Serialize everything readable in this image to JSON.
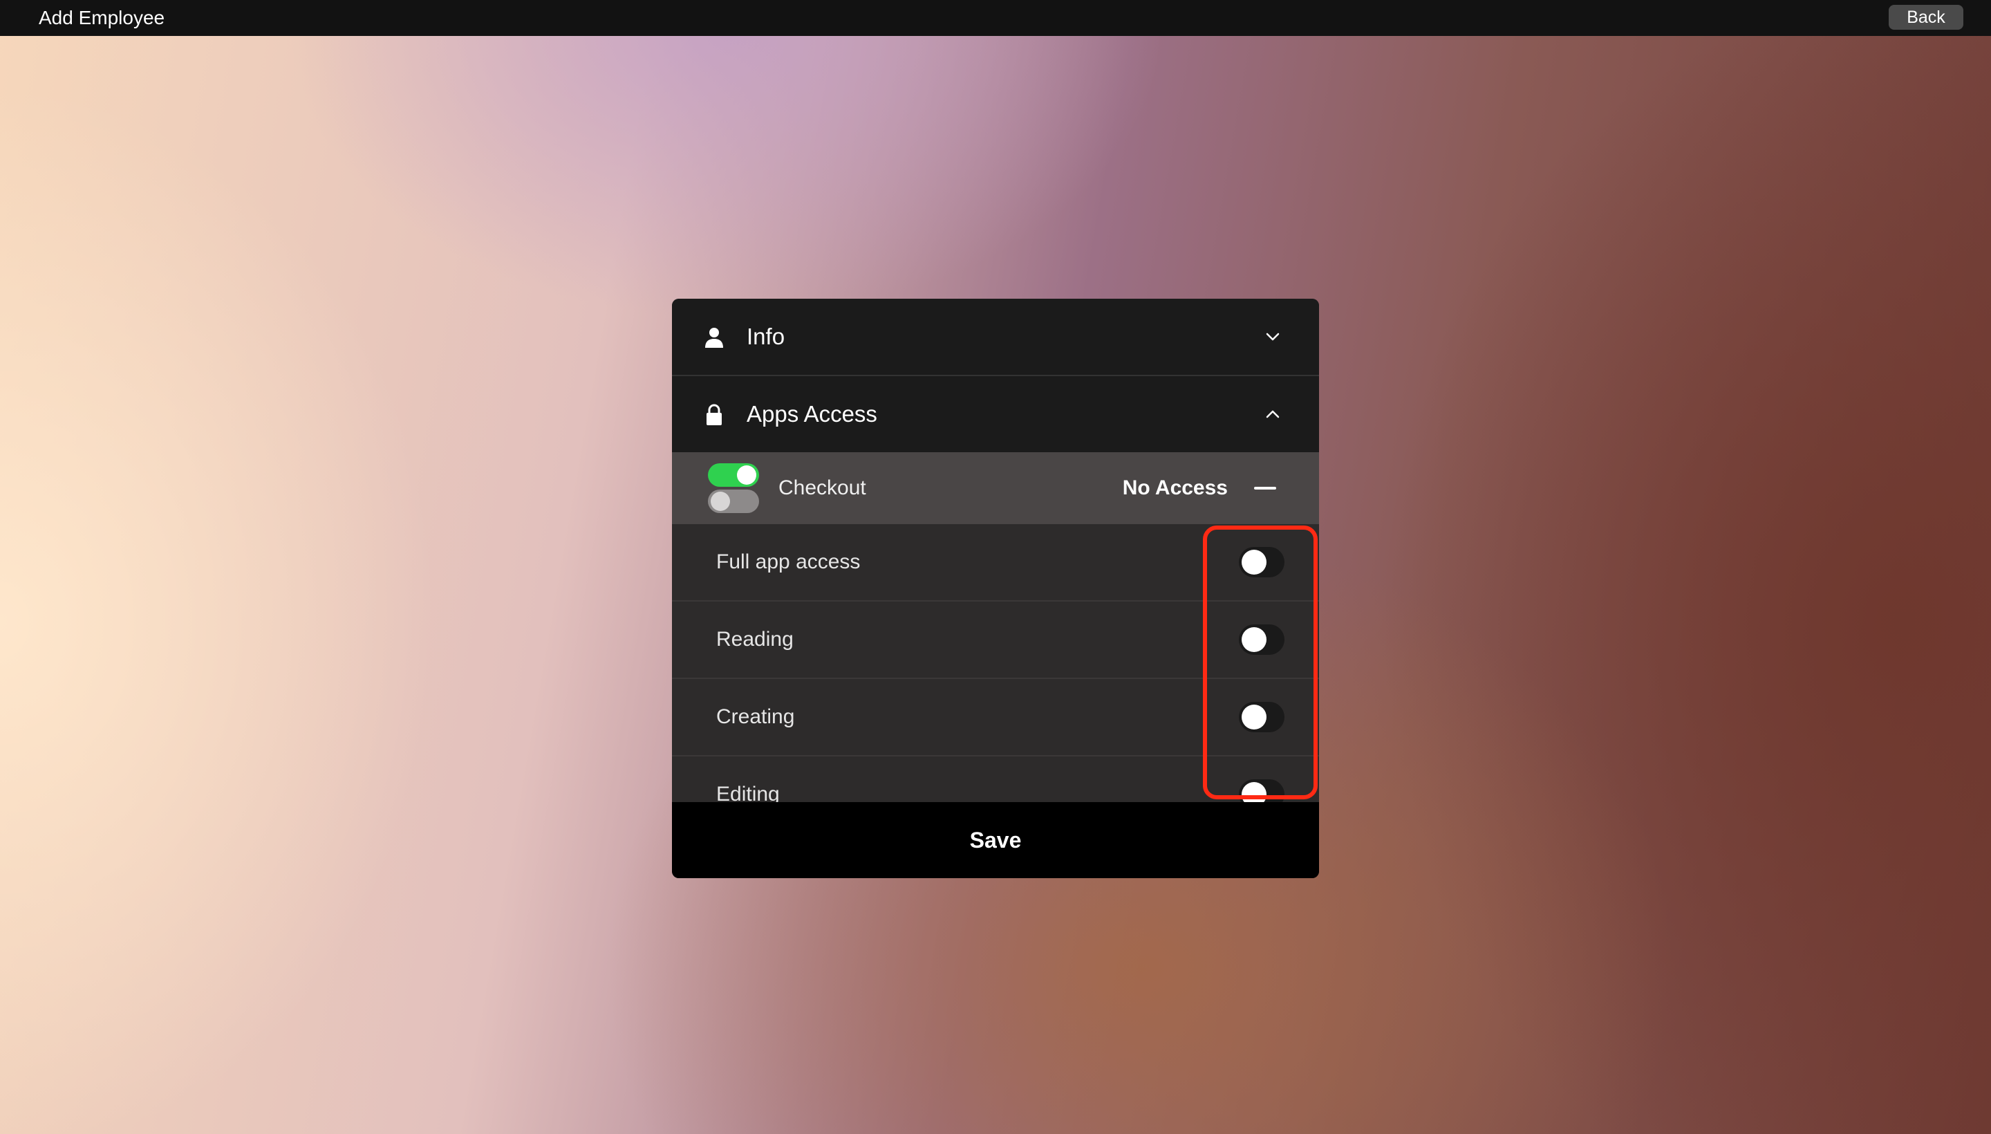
{
  "window": {
    "title": "Add Employee",
    "back_label": "Back"
  },
  "sections": {
    "info": {
      "label": "Info",
      "icon": "person-icon",
      "expanded": false
    },
    "apps_access": {
      "label": "Apps Access",
      "icon": "lock-icon",
      "expanded": true
    }
  },
  "app": {
    "name": "Checkout",
    "icon": "toggles-app-icon",
    "access_status": "No Access",
    "collapse_icon": "minus-icon"
  },
  "permissions": [
    {
      "label": "Full app access",
      "enabled": false
    },
    {
      "label": "Reading",
      "enabled": false
    },
    {
      "label": "Creating",
      "enabled": false
    },
    {
      "label": "Editing",
      "enabled": false
    }
  ],
  "save_label": "Save",
  "colors": {
    "highlight": "#ff2a14",
    "app_icon_green": "#2fd14f",
    "panel": "#1b1b1b"
  }
}
